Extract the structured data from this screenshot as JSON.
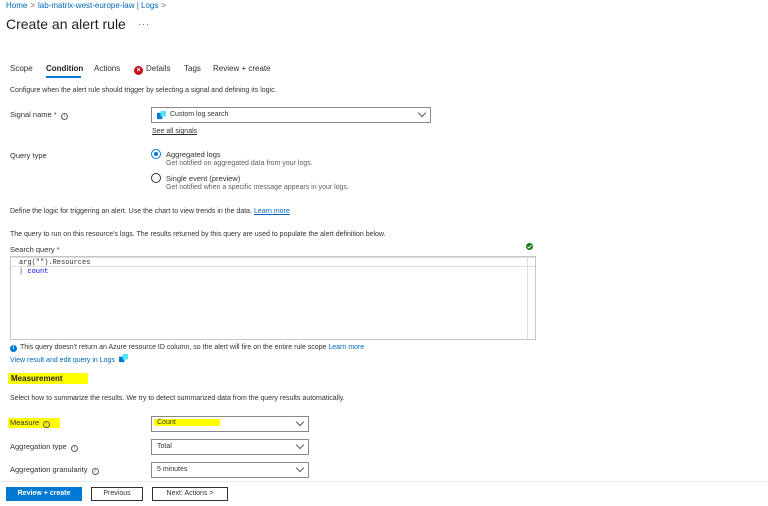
{
  "breadcrumb": {
    "home": "Home",
    "resource": "lab-matrix-west-europe-law | Logs"
  },
  "page": {
    "title": "Create an alert rule",
    "more": "···"
  },
  "tabs": [
    {
      "label": "Scope"
    },
    {
      "label": "Condition",
      "active": true
    },
    {
      "label": "Actions"
    },
    {
      "label": "Details",
      "error": true
    },
    {
      "label": "Tags"
    },
    {
      "label": "Review + create"
    }
  ],
  "intro": "Configure when the alert rule should trigger by selecting a signal and defining its logic.",
  "signal": {
    "label": "Signal name",
    "required": "*",
    "value": "Custom log search",
    "see_all": "See all signals"
  },
  "query_type": {
    "label": "Query type",
    "options": [
      {
        "title": "Aggregated logs",
        "desc": "Get notified on aggregated data from your logs.",
        "selected": true
      },
      {
        "title": "Single event (preview)",
        "desc": "Get notified when a specific message appears in your logs.",
        "selected": false
      }
    ]
  },
  "logic": {
    "text": "Define the logic for triggering an alert. Use the chart to view trends in the data.",
    "learn_more": "Learn more"
  },
  "query": {
    "intro": "The query to run on this resource's logs. The results returned by this query are used to populate the alert definition below.",
    "label": "Search query",
    "required": "*",
    "line1": "arg(\"\").Resources",
    "line2_pipe": "|",
    "line2_kw": "count",
    "notice": "This query doesn't return an Azure resource ID column, so the alert will fire on the entire rule scope",
    "notice_link": "Learn more",
    "view_link": "View result and edit query in Logs"
  },
  "measurement": {
    "heading": "Measurement",
    "desc": "Select how to summarize the results. We try to detect summarized data from the query results automatically.",
    "measure_label": "Measure",
    "measure_value": "Count",
    "aggtype_label": "Aggregation type",
    "aggtype_value": "Total",
    "granularity_label": "Aggregation granularity",
    "granularity_value": "5 minutes"
  },
  "footer": {
    "review": "Review + create",
    "previous": "Previous",
    "next": "Next: Actions >"
  },
  "colors": {
    "accent": "#0078d4",
    "error": "#c50f1f",
    "highlight": "#ffff00",
    "success": "#107c10"
  }
}
